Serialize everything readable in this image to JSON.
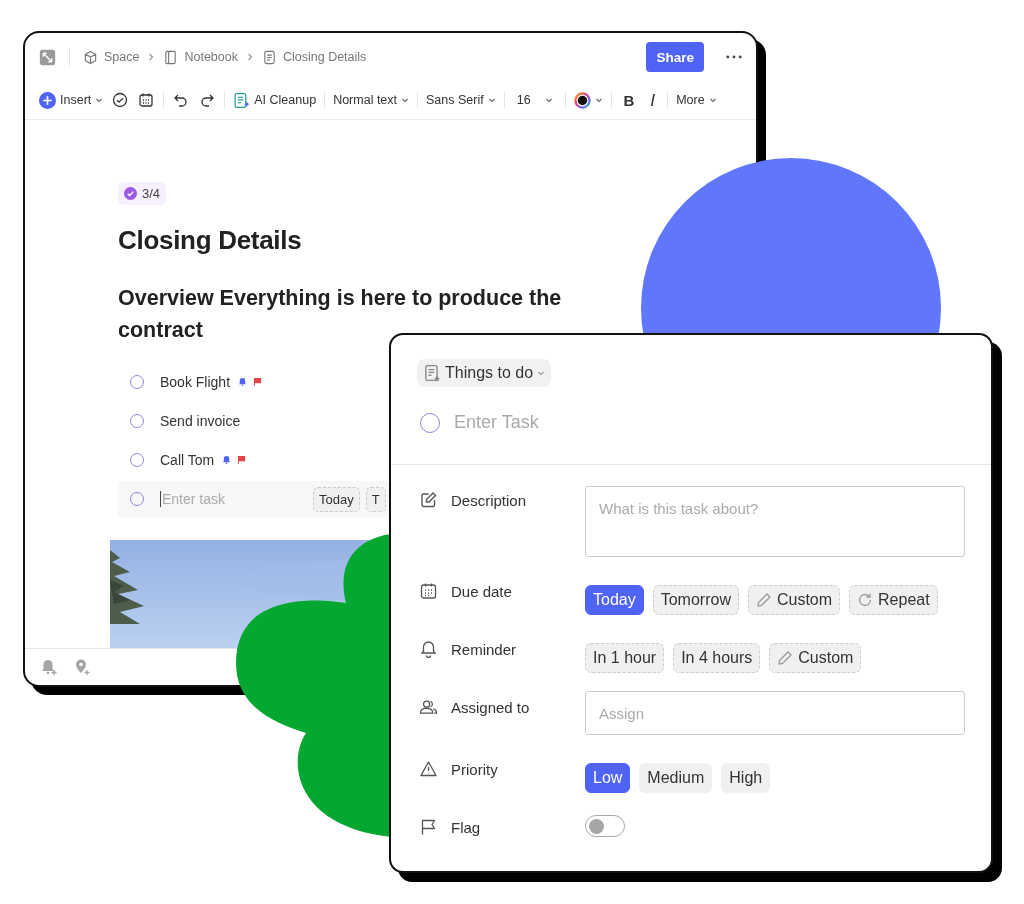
{
  "editor": {
    "breadcrumb": [
      "Space",
      "Notebook",
      "Closing Details"
    ],
    "share_button": "Share",
    "toolbar": {
      "insert": "Insert",
      "ai_cleanup": "AI Cleanup",
      "text_style": "Normal text",
      "font": "Sans Serif",
      "size": "16",
      "bold": "B",
      "italic": "I",
      "more": "More"
    },
    "progress": "3/4",
    "title": "Closing Details",
    "heading": "Overview Everything is here to produce the contract",
    "tasks": [
      {
        "text": "Book Flight",
        "checked": false,
        "reminder": true,
        "flag": true
      },
      {
        "text": "Send invoice",
        "checked": false,
        "reminder": false,
        "flag": false
      },
      {
        "text": "Call Tom",
        "checked": false,
        "reminder": true,
        "flag": true
      }
    ],
    "new_task": {
      "placeholder": "Enter task",
      "checked": false,
      "chips": [
        "Today",
        "T"
      ]
    }
  },
  "task_panel": {
    "list": "Things to do",
    "task_checked": false,
    "task_placeholder": "Enter Task",
    "description": {
      "label": "Description",
      "placeholder": "What is this task about?"
    },
    "due_date": {
      "label": "Due date",
      "options": [
        {
          "label": "Today",
          "kind": "plain",
          "selected": true
        },
        {
          "label": "Tomorrow",
          "kind": "plain",
          "selected": false
        },
        {
          "label": "Custom",
          "kind": "custom",
          "selected": false
        },
        {
          "label": "Repeat",
          "kind": "repeat",
          "selected": false
        }
      ]
    },
    "reminder": {
      "label": "Reminder",
      "options": [
        {
          "label": "In 1 hour",
          "kind": "plain",
          "selected": false
        },
        {
          "label": "In 4 hours",
          "kind": "plain",
          "selected": false
        },
        {
          "label": "Custom",
          "kind": "custom",
          "selected": false
        }
      ]
    },
    "assigned": {
      "label": "Assigned to",
      "placeholder": "Assign"
    },
    "priority": {
      "label": "Priority",
      "options": [
        {
          "label": "Low",
          "selected": true
        },
        {
          "label": "Medium",
          "selected": false
        },
        {
          "label": "High",
          "selected": false
        }
      ]
    },
    "flag": {
      "label": "Flag",
      "on": false
    }
  }
}
